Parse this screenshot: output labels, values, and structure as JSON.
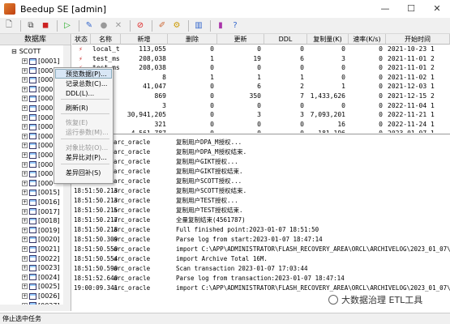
{
  "window": {
    "title": "Beedup SE [admin]",
    "min": "—",
    "max": "☐",
    "close": "✕"
  },
  "left": {
    "header": "数据库",
    "root": "SCOTT",
    "items": [
      "[0001]",
      "[000",
      "[000",
      "[000",
      "[000",
      "[000",
      "[000",
      "[000",
      "[000",
      "[000",
      "[000",
      "[000",
      "[000",
      "[000",
      "[0015]",
      "[0016]",
      "[0017]",
      "[0018]",
      "[0019]",
      "[0020]",
      "[0021]",
      "[0022]",
      "[0023]",
      "[0024]",
      "[0025]",
      "[0026]",
      "[0027]"
    ]
  },
  "grid": {
    "headers": [
      "状态",
      "名称",
      "新增",
      "删除",
      "更新",
      "DDL",
      "复制量(K)",
      "速率(K/s)",
      "开始时间"
    ],
    "rows": [
      [
        "local_test",
        "113,055",
        "0",
        "0",
        "0",
        "0",
        "0",
        "2021-10-23 1"
      ],
      [
        "test_mssql1",
        "208,038",
        "1",
        "19",
        "6",
        "3",
        "0",
        "2021-11-01 2"
      ],
      [
        "test_mssql_r...",
        "208,038",
        "0",
        "0",
        "0",
        "0",
        "0",
        "2021-11-01 2"
      ],
      [
        "",
        "8",
        "1",
        "1",
        "1",
        "0",
        "0",
        "2021-11-02 1"
      ],
      [
        "",
        "41,047",
        "0",
        "6",
        "2",
        "1",
        "0",
        "2021-12-03 1"
      ],
      [
        "",
        "869",
        "0",
        "350",
        "7",
        "1,433,626",
        "0",
        "2021-12-15 2"
      ],
      [
        "",
        "3",
        "0",
        "0",
        "0",
        "0",
        "0",
        "2022-11-04 1"
      ],
      [
        "sql",
        "30,941,205",
        "0",
        "3",
        "3",
        "7,093,201",
        "0",
        "2022-11-21 1"
      ],
      [
        "2",
        "321",
        "0",
        "0",
        "0",
        "16",
        "0",
        "2022-11-24 1"
      ],
      [
        "racle",
        "4,561,787",
        "0",
        "0",
        "0",
        "181,196",
        "0",
        "2023-01-07 1"
      ]
    ]
  },
  "menu": {
    "items": [
      "预览数据(P)...",
      "记录总数(C)...",
      "DDL(L)...",
      "刷新(R)",
      "恢复(E)",
      "运行参数(M)...",
      "对象比较(O)...",
      "差异比对(P)...",
      "差异回补(S)"
    ]
  },
  "log": {
    "rows": [
      [
        "",
        "arc_oracle",
        "复制用户DPA_M授权..."
      ],
      [
        "",
        "arc_oracle",
        "复制用户DPA_M授权结束."
      ],
      [
        "",
        "arc_oracle",
        "复制用户GIKT授权..."
      ],
      [
        "",
        "arc_oracle",
        "复制用户GIKT授权结束."
      ],
      [
        "",
        "arc_oracle",
        "复制用户SCOTT授权..."
      ],
      [
        "18:51:50.213",
        "arc_oracle",
        "复制用户SCOTT授权结束."
      ],
      [
        "18:51:50.213",
        "arc_oracle",
        "复制用户TEST授权..."
      ],
      [
        "18:51:50.215",
        "arc_oracle",
        "复制用户TEST授权结束."
      ],
      [
        "18:51:50.217",
        "arc_oracle",
        "全量复制结束(4561787)"
      ],
      [
        "18:51:50.218",
        "arc_oracle",
        "Full finished point:2023-01-07 18:51:50"
      ],
      [
        "18:51:50.309",
        "arc_oracle",
        "Parse log from start:2023-01-07 18:47:14"
      ],
      [
        "18:51:50.550",
        "arc_oracle",
        "import C:\\APP\\ADMINISTRATOR\\FLASH_RECOVERY_AREA\\ORCL\\ARCHIVELOG\\2023_01_07\\O1_MF_1_247"
      ],
      [
        "18:51:50.554",
        "arc_oracle",
        "import Archive Total 16M."
      ],
      [
        "18:51:50.590",
        "arc_oracle",
        "Scan transaction 2023-01-07 17:03:44"
      ],
      [
        "18:51:52.640",
        "arc_oracle",
        "Parse log from transaction:2023-01-07 18:47:14"
      ],
      [
        "19:00:09.341",
        "arc_oracle",
        "import C:\\APP\\ADMINISTRATOR\\FLASH_RECOVERY_AREA\\ORCL\\ARCHIVELOG\\2023_01_07\\O1_MF_1_248"
      ]
    ]
  },
  "status": "停止选中任务",
  "watermark": "大数据治理 ETL工具"
}
